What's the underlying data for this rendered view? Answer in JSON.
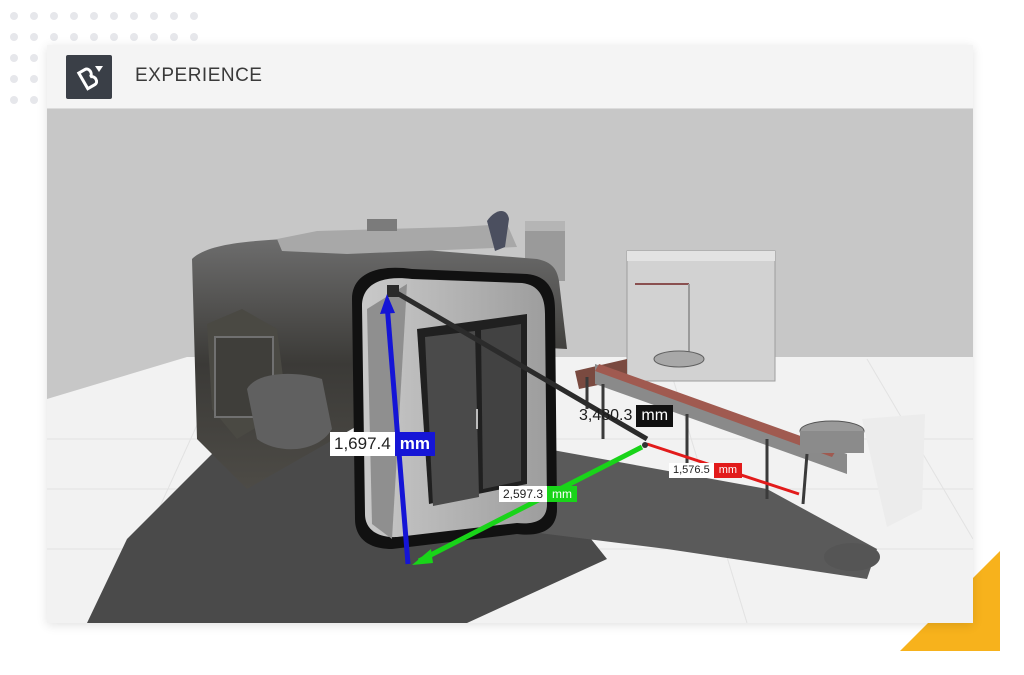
{
  "app": {
    "title": "EXPERIENCE",
    "logo": "vectary-logo"
  },
  "viewport": {
    "scene": "3d-machine-layout",
    "measurements": [
      {
        "id": "height",
        "value": "1,697.4",
        "unit": "mm",
        "color": "#1515d6"
      },
      {
        "id": "diagonal",
        "value": "3,480.3",
        "unit": "mm",
        "color": "#111111"
      },
      {
        "id": "width",
        "value": "2,597.3",
        "unit": "mm",
        "color": "#19d419"
      },
      {
        "id": "depth",
        "value": "1,576.5",
        "unit": "mm",
        "color": "#e21b1b"
      }
    ]
  },
  "colors": {
    "accent": "#f7b21c",
    "background_wall": "#c7c7c7",
    "floor": "#f2f2f2"
  }
}
